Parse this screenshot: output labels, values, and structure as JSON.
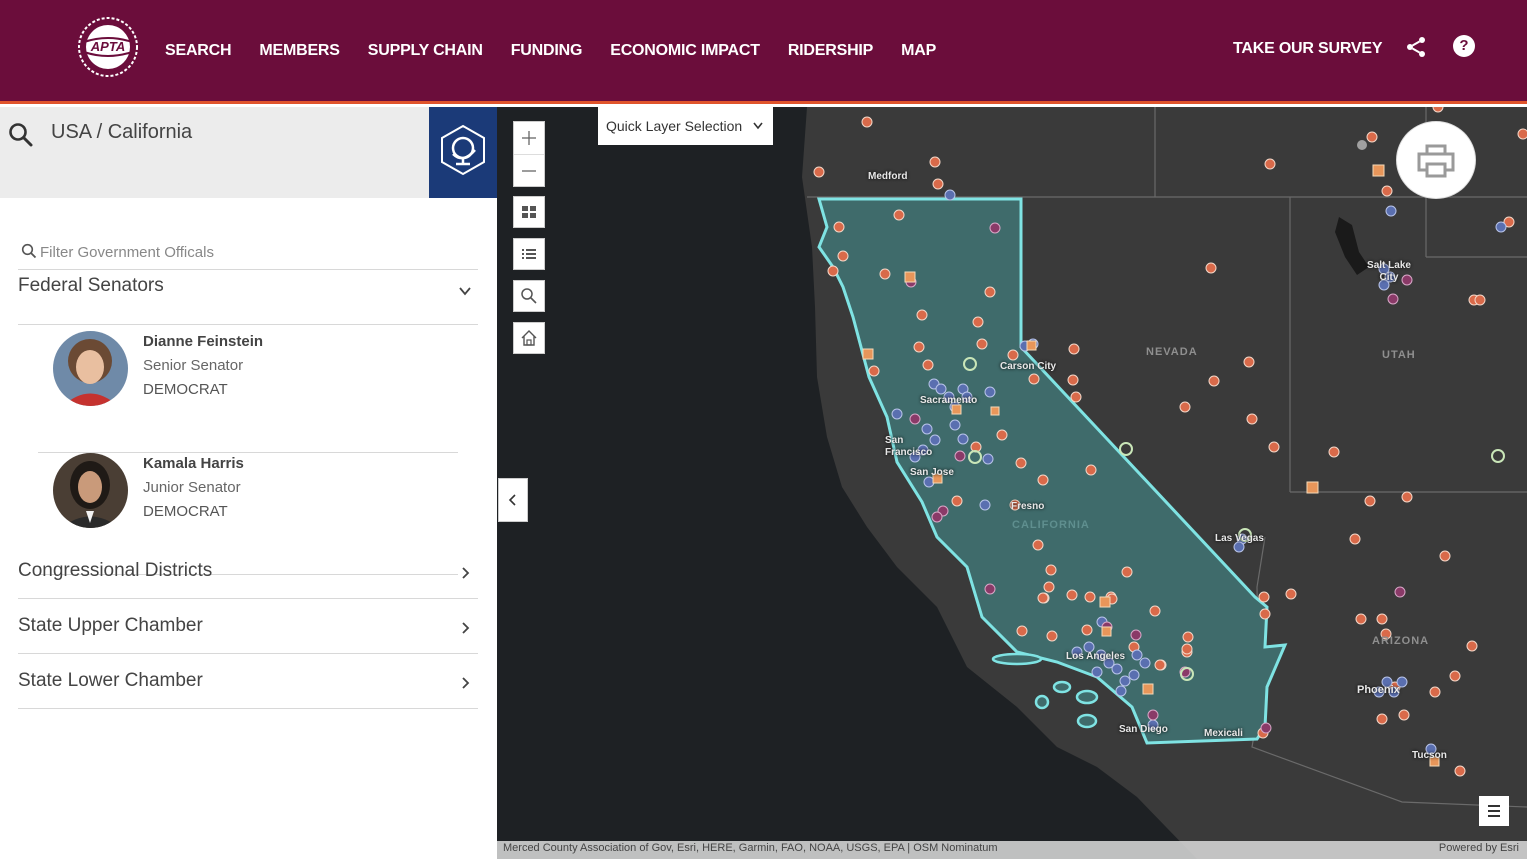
{
  "header": {
    "logo_text": "APTA",
    "nav": [
      "SEARCH",
      "MEMBERS",
      "SUPPLY CHAIN",
      "FUNDING",
      "ECONOMIC IMPACT",
      "RIDERSHIP",
      "MAP"
    ],
    "survey_label": "TAKE OUR SURVEY",
    "help_label": "?"
  },
  "sidebar": {
    "search_value": "USA / California",
    "filter_placeholder": "Filter Government Officals",
    "federal_title": "Federal Senators",
    "senators": [
      {
        "name": "Dianne Feinstein",
        "role": "Senior Senator",
        "party": "DEMOCRAT"
      },
      {
        "name": "Kamala Harris",
        "role": "Junior Senator",
        "party": "DEMOCRAT"
      }
    ],
    "sections": [
      "Congressional Districts",
      "State Upper Chamber",
      "State Lower Chamber"
    ]
  },
  "map": {
    "quick_layer_label": "Quick Layer Selection",
    "city_labels": [
      "Medford",
      "Carson City",
      "Sacramento",
      "San Francisco",
      "San Jose",
      "Fresno",
      "Las Vegas",
      "Los Angeles",
      "San Diego",
      "Mexicali",
      "Salt Lake City",
      "Phoenix",
      "Tucson"
    ],
    "state_labels": [
      "NEVADA",
      "UTAH",
      "CALIFORNIA",
      "ARIZONA"
    ],
    "attribution": "Merced County Association of Gov, Esri, HERE, Garmin, FAO, NOAA, USGS, EPA | OSM Nominatum",
    "powered_by": "Powered by Esri",
    "colors": {
      "highlight": "#3f6b6b",
      "outline": "#7fe3e3",
      "point_orange": "#d96a4a",
      "point_blue": "#5a6fb0",
      "point_purple": "#8a3a68"
    }
  }
}
